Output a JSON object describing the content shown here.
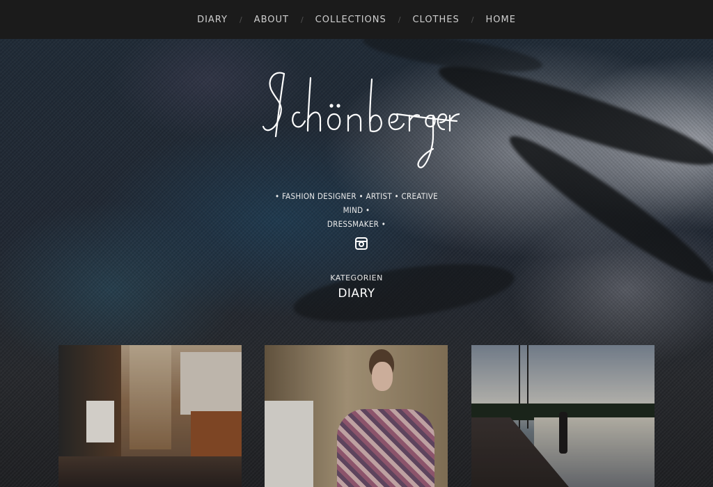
{
  "nav": {
    "items": [
      {
        "label": "DIARY"
      },
      {
        "label": "ABOUT"
      },
      {
        "label": "COLLECTIONS"
      },
      {
        "label": "CLOTHES"
      },
      {
        "label": "HOME"
      }
    ],
    "separator": "/"
  },
  "hero": {
    "logo_text": "Schönberger",
    "tagline_line1": "• FASHION DESIGNER • ARTIST • CREATIVE MIND •",
    "tagline_line2": "DRESSMAKER •",
    "social_icon": "instagram-icon"
  },
  "category": {
    "label": "KATEGORIEN",
    "title": "DIARY"
  },
  "posts": [
    {
      "image": "studio-room-photo"
    },
    {
      "image": "woman-measuring-tape-photo"
    },
    {
      "image": "harbor-sailboats-photo"
    }
  ],
  "colors": {
    "nav_bg": "#1b1b1b",
    "nav_text": "#cfcfcf",
    "text": "#ffffff"
  }
}
